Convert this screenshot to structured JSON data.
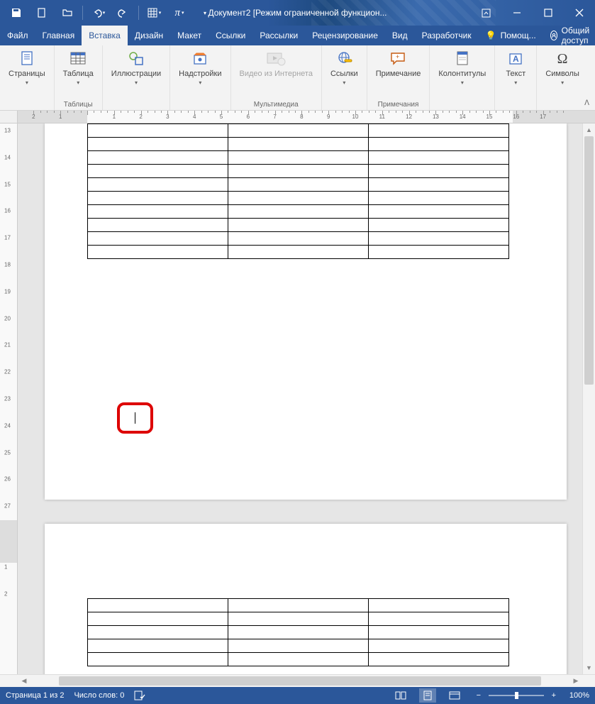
{
  "title": "Документ2 [Режим ограниченной функцион...",
  "tabs": {
    "file": "Файл",
    "home": "Главная",
    "insert": "Вставка",
    "design": "Дизайн",
    "layout": "Макет",
    "references": "Ссылки",
    "mailings": "Рассылки",
    "review": "Рецензирование",
    "view": "Вид",
    "developer": "Разработчик"
  },
  "help_placeholder": "Помощ...",
  "share": "Общий доступ",
  "ribbon": {
    "pages": {
      "label": "Страницы",
      "btn": "Страницы"
    },
    "tables": {
      "label": "Таблицы",
      "btn": "Таблица"
    },
    "illustrations": {
      "label": "",
      "btn": "Иллюстрации"
    },
    "addins": {
      "label": "",
      "btn": "Надстройки"
    },
    "media": {
      "label": "Мультимедиа",
      "btn": "Видео из Интернета"
    },
    "links": {
      "label": "",
      "btn": "Ссылки"
    },
    "comments": {
      "label": "Примечания",
      "btn": "Примечание"
    },
    "header_footer": {
      "label": "",
      "btn": "Колонтитулы"
    },
    "text": {
      "label": "",
      "btn": "Текст"
    },
    "symbols": {
      "label": "",
      "btn": "Символы"
    }
  },
  "statusbar": {
    "page": "Страница 1 из 2",
    "words": "Число слов: 0",
    "zoom": "100%"
  },
  "ruler_h_labels": [
    "2",
    "1",
    "",
    "1",
    "2",
    "3",
    "4",
    "5",
    "6",
    "7",
    "8",
    "9",
    "10",
    "11",
    "12",
    "13",
    "14",
    "15",
    "16",
    "17"
  ],
  "ruler_v_labels": [
    "13",
    "14",
    "15",
    "16",
    "17",
    "18",
    "19",
    "20",
    "21",
    "22",
    "23",
    "24",
    "25",
    "26",
    "27"
  ],
  "ruler_v_labels2": [
    "1",
    "2"
  ],
  "table1_rows": 10,
  "table2_rows": 5,
  "table_cols": 3
}
